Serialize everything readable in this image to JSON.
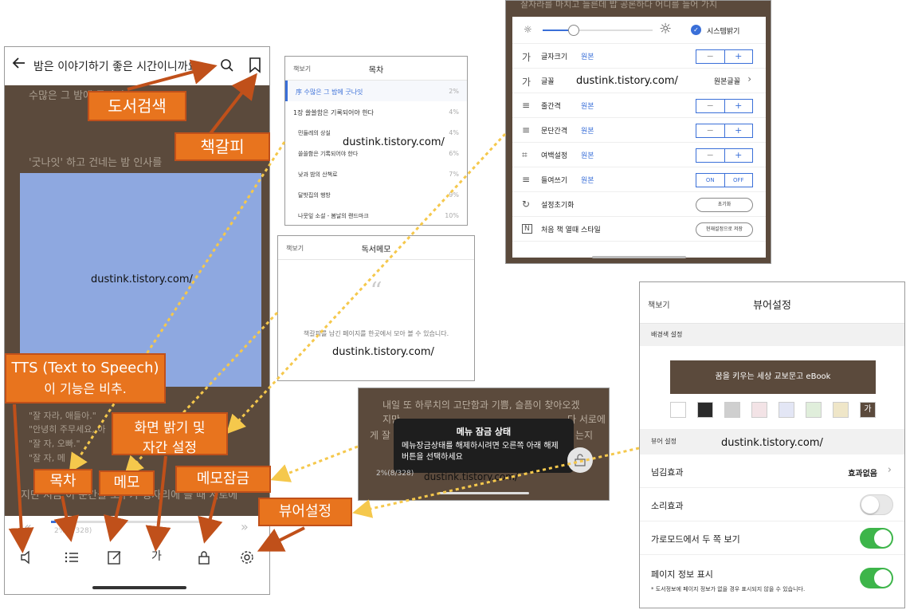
{
  "watermark": "dustink.tistory.com/",
  "phone": {
    "book_title": "밤은 이야기하기 좋은 시간이니까요",
    "reader_lines": [
      "수많은 그 밤에 굿나잇",
      "'굿나잇' 하고 건네는 밤 인사를 "
    ],
    "reader_lower_lines": [
      "\"잘 자라, 애들아.\"",
      "\"안녕히 주무세요, 아",
      "\"잘 자, 오빠.\"",
      "\"잘 자, 메",
      "나",
      "지만 지금 이 순간을 모두가 정자리에 들 때 서로에"
    ],
    "page_info": "2%(8/328)"
  },
  "toc": {
    "back_label": "책보기",
    "title": "목차",
    "items": [
      {
        "label": "序 수많은 그 밤에 굿나잇",
        "pct": "2%"
      },
      {
        "label": "1장 쓸쓸함은 기록되어야 한다",
        "pct": "4%"
      },
      {
        "label": "민들레의 상실",
        "pct": "4%"
      },
      {
        "label": "쓸쓸함은 기록되어야 한다",
        "pct": "6%"
      },
      {
        "label": "낮과 밤의 산책로",
        "pct": "7%"
      },
      {
        "label": "달밧집의 행방",
        "pct": "9%"
      },
      {
        "label": "나뭇잎 소설 - 봄날의 랜드마크",
        "pct": "10%"
      }
    ]
  },
  "memo": {
    "back_label": "책보기",
    "title": "독서메모",
    "quote_mark": "“",
    "empty_text": "책갈피를 남긴 페이지를 한곳에서 모아 볼 수 있습니다."
  },
  "brightness": {
    "top_text": "잘자라를 마치고 들른데 밥 공론하다 어디를 들어 가지",
    "system_label": "시스템밝기",
    "rows": [
      {
        "icon": "가",
        "name": "글자크기",
        "value": "원본"
      },
      {
        "icon": "가",
        "name": "글꼴",
        "value": "원본글꼴"
      },
      {
        "icon": "≡",
        "name": "줄간격",
        "value": "원본"
      },
      {
        "icon": "≡",
        "name": "문단간격",
        "value": "원본"
      },
      {
        "icon": "⌗",
        "name": "여백설정",
        "value": "원본"
      },
      {
        "icon": "≡",
        "name": "들여쓰기",
        "value": "원본"
      },
      {
        "icon": "↻",
        "name": "설정초기화",
        "value": ""
      },
      {
        "icon": "N",
        "name": "처음 책 열때 스타일",
        "value": ""
      }
    ],
    "minus": "−",
    "plus": "+",
    "on": "ON",
    "off": "OFF",
    "reset_btn": "초기화",
    "save_btn": "현재설정으로 저장"
  },
  "lock": {
    "line1": "내일 또 하루치의 고단함과 기쁨, 슬픔이 찾아오겠",
    "line2": "지만",
    "line2b": "다 서로에",
    "line3": "게 잘",
    "line3b": "는지",
    "toast_title": "메뉴 잠금 상태",
    "toast_body": "메뉴장금상태를 해제하시려면 오른쪽 아래 해제 버튼을 선택하세요",
    "page_info": "2%(8/328)"
  },
  "viewer": {
    "back_label": "책보기",
    "title": "뷰어설정",
    "bg_section": "배경색 설정",
    "preview_text": "꿈을 키우는 세상 교보문고 eBook",
    "swatches": [
      "#ffffff",
      "#2b2b2b",
      "#cfcfcf",
      "#f3e3e6",
      "#e3e6f5",
      "#e0eedb",
      "#efe6c8",
      "#5b4a3c"
    ],
    "last_swatch_label": "가",
    "viewer_section": "뷰어 설정",
    "page_effect_label": "넘김효과",
    "page_effect_value": "효과없음",
    "sound_label": "소리효과",
    "sound_on": false,
    "landscape_label": "가로모드에서 두 쪽 보기",
    "landscape_on": true,
    "pageinfo_label": "페이지 정보 표시",
    "pageinfo_on": true,
    "pageinfo_note": "* 도서정보에 페이지 정보가 없을 경우 표시되지 않을 수 있습니다."
  },
  "notes": {
    "search": "도서검색",
    "bookmark": "책갈피",
    "tts": "TTS (Text to Speech)",
    "tts_sub": "이 기능은 비추.",
    "brightness": "화면 밝기 및",
    "brightness2": "자간 설정",
    "toc": "목차",
    "memo": "메모",
    "lock": "메모잠금",
    "viewer": "뷰어설정"
  },
  "colors": {
    "accent": "#e8741e",
    "reader_bg": "#5b4a3c",
    "link_blue": "#3a6fd8",
    "toggle_on": "#3db54a"
  }
}
